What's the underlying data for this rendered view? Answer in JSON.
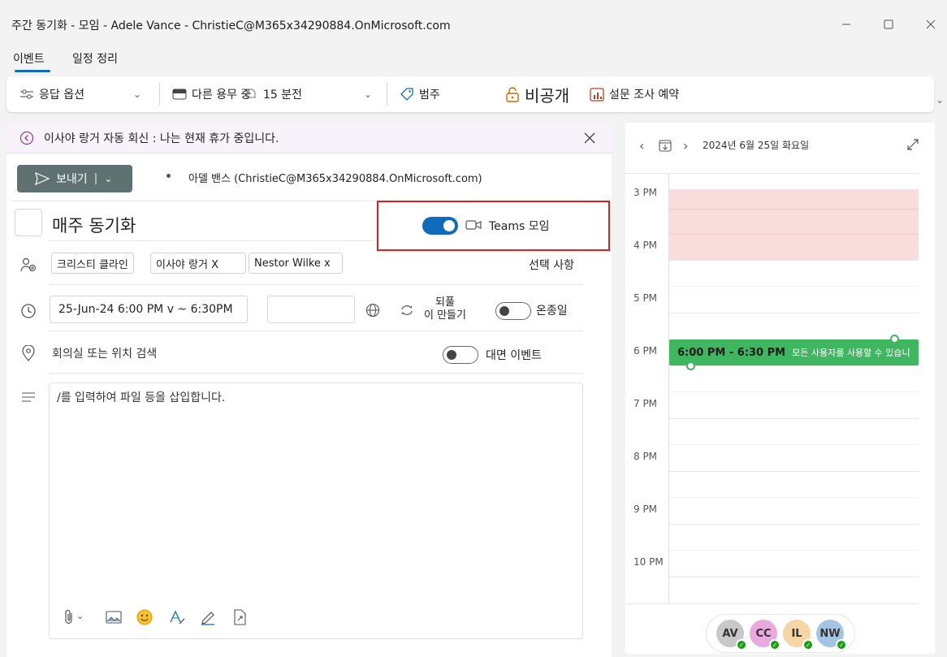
{
  "window": {
    "title": "주간 동기화 - 모임 - Adele Vance - ChristieC@M365x34290884.OnMicrosoft.com"
  },
  "tabs": [
    {
      "label": "이벤트"
    },
    {
      "label": "일정 정리"
    }
  ],
  "ribbon": {
    "response_options": "응답 옵션",
    "busy_status": "다른 용무 중",
    "reminder": "15 분전",
    "category": "범주",
    "private": "비공개",
    "poll": "설문 조사 예약"
  },
  "notice": {
    "text": "이사야 랑거 자동 회신 : 나는 현재 휴가 중입니다."
  },
  "compose": {
    "send_label": "보내기",
    "from": "아델 밴스 (ChristieC@M365x34290884.OnMicrosoft.com)",
    "title": "매주 동기화",
    "teams_label": "Teams 모임",
    "teams_enabled": true,
    "attendees": [
      "크리스티 클라인",
      "이사야 랑거 X",
      "Nestor Wilke x"
    ],
    "optional_label": "선택 사항",
    "datetime": "25-Jun-24 6:00 PM v ~ 6:30PM",
    "recurring_label": "되풀\n이 만들기",
    "all_day_label": "온종일",
    "all_day": false,
    "location_placeholder": "회의실 또는 위치 검색",
    "in_person_label": "대면 이벤트",
    "in_person": false,
    "body_placeholder": "/를 입력하여 파일 등을 삽입합니다."
  },
  "calendar": {
    "date": "2024년 6월 25일 화요일",
    "hours": [
      "3 PM",
      "4 PM",
      "5 PM",
      "6 PM",
      "7 PM",
      "8 PM",
      "9 PM",
      "10 PM"
    ],
    "event_time": "6:00 PM - 6:30 PM",
    "event_status": "모든 사용자를 사용할 수 있습니",
    "event_color": "#3fb760",
    "busy_color": "#f9dcdc",
    "attendees": [
      {
        "initials": "AV",
        "color": "#c8c8c8"
      },
      {
        "initials": "CC",
        "color": "#e9a8de"
      },
      {
        "initials": "IL",
        "color": "#f6d6a4"
      },
      {
        "initials": "NW",
        "color": "#a4c4e4"
      }
    ]
  },
  "highlight_color": "#e01e1e"
}
